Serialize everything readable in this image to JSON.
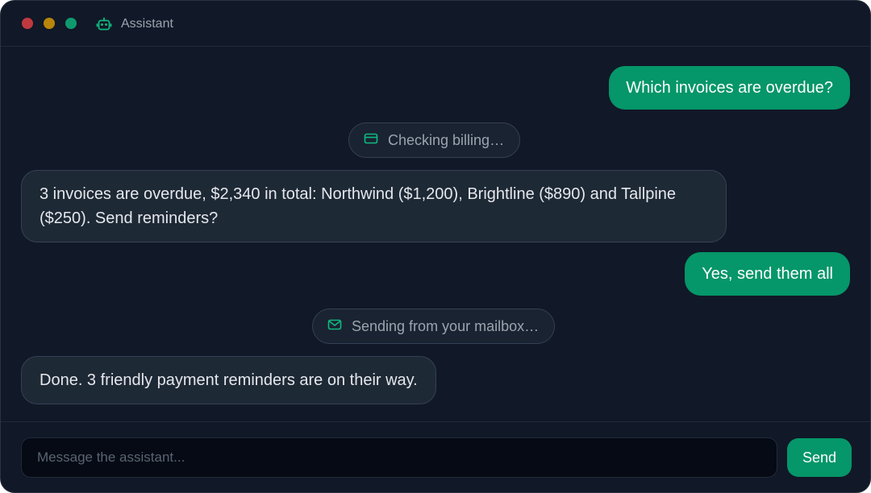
{
  "window": {
    "title": "Assistant",
    "app_icon": "robot-icon",
    "controls": {
      "close_color": "#c0393f",
      "minimize_color": "#b8860b",
      "maximize_color": "#0f9a6e"
    }
  },
  "theme": {
    "accent": "#059669",
    "background": "#111827",
    "bubble_assistant": "#1e2936"
  },
  "messages": [
    {
      "role": "user",
      "text": "Which invoices are overdue?"
    },
    {
      "role": "tool",
      "icon": "credit-card-icon",
      "text": "Checking billing…"
    },
    {
      "role": "assistant",
      "text": "3 invoices are overdue, $2,340 in total: Northwind ($1,200), Brightline ($890) and Tallpine ($250). Send reminders?"
    },
    {
      "role": "user",
      "text": "Yes, send them all"
    },
    {
      "role": "tool",
      "icon": "mail-icon",
      "text": "Sending from your mailbox…"
    },
    {
      "role": "assistant",
      "text": "Done. 3 friendly payment reminders are on their way."
    }
  ],
  "composer": {
    "placeholder": "Message the assistant...",
    "value": "",
    "send_label": "Send"
  }
}
